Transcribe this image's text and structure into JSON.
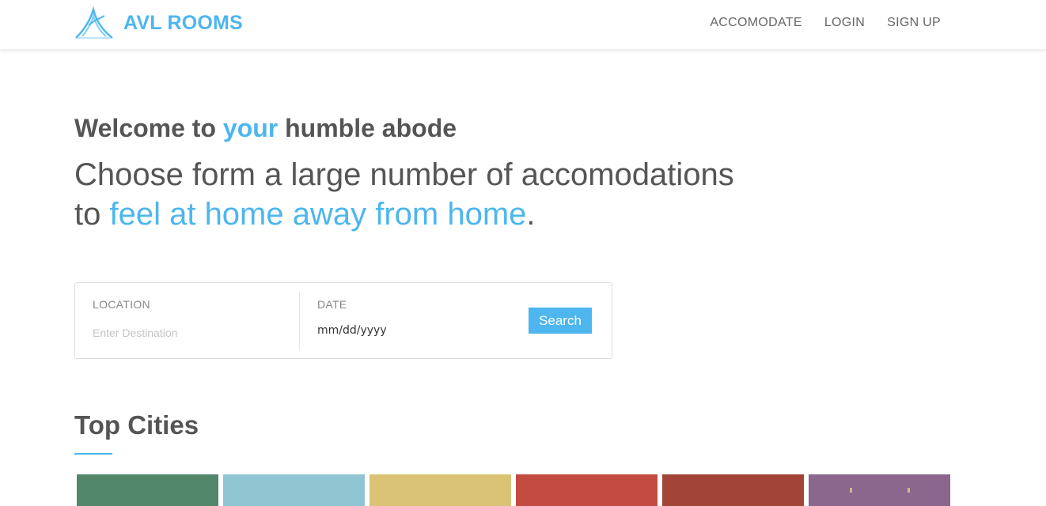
{
  "brand": {
    "name": "AVL ROOMS",
    "logo_icon": "mountain-logo-icon",
    "color": "#4db6ef"
  },
  "nav": {
    "items": [
      "ACCOMODATE",
      "LOGIN",
      "SIGN UP"
    ]
  },
  "hero": {
    "welcome_prefix": "Welcome to ",
    "welcome_accent": "your",
    "welcome_suffix": " humble abode",
    "tagline_line1": "Choose form a large number of accomodations",
    "tagline_to": "to ",
    "tagline_accent": "feel at home away from home",
    "tagline_end": "."
  },
  "search": {
    "location_label": "LOCATION",
    "location_placeholder": "Enter Destination",
    "date_label": "DATE",
    "date_placeholder": "mm/dd/yyyy",
    "button_label": "Search"
  },
  "top_cities": {
    "title": "Top Cities",
    "tile_colors": [
      "#52876c",
      "#8fc6d1",
      "#dbc375",
      "#c34b41",
      "#a24536",
      "#8b668d"
    ]
  },
  "colors": {
    "accent": "#4db6ef",
    "text": "#555555"
  }
}
